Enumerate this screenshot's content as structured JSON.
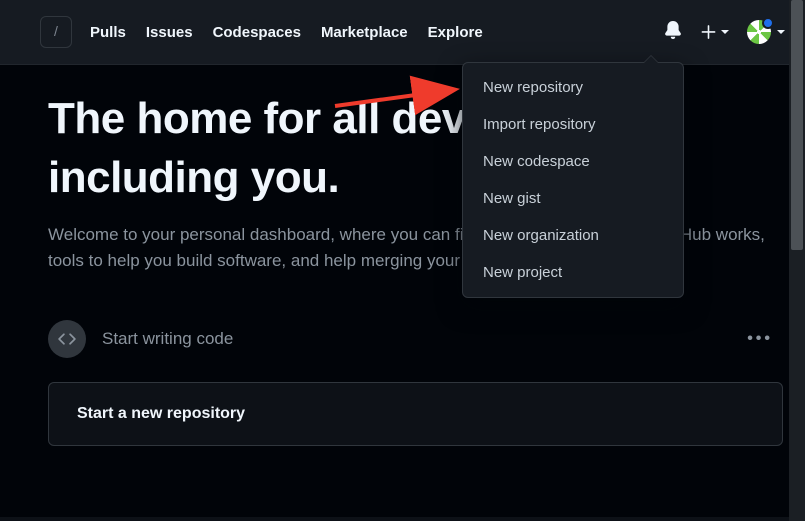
{
  "header": {
    "search_slash": "/",
    "nav": [
      "Pulls",
      "Issues",
      "Codespaces",
      "Marketplace",
      "Explore"
    ]
  },
  "dropdown": {
    "items": [
      "New repository",
      "Import repository",
      "New codespace",
      "New gist",
      "New organization",
      "New project"
    ]
  },
  "hero": {
    "title_line1": "The home for all developers —",
    "title_line2": "including you.",
    "subtitle": "Welcome to your personal dashboard, where you can find an introduction to how GitHub works, tools to help you build software, and help merging your first lines of code."
  },
  "section": {
    "label": "Start writing code",
    "card_title": "Start a new repository"
  }
}
